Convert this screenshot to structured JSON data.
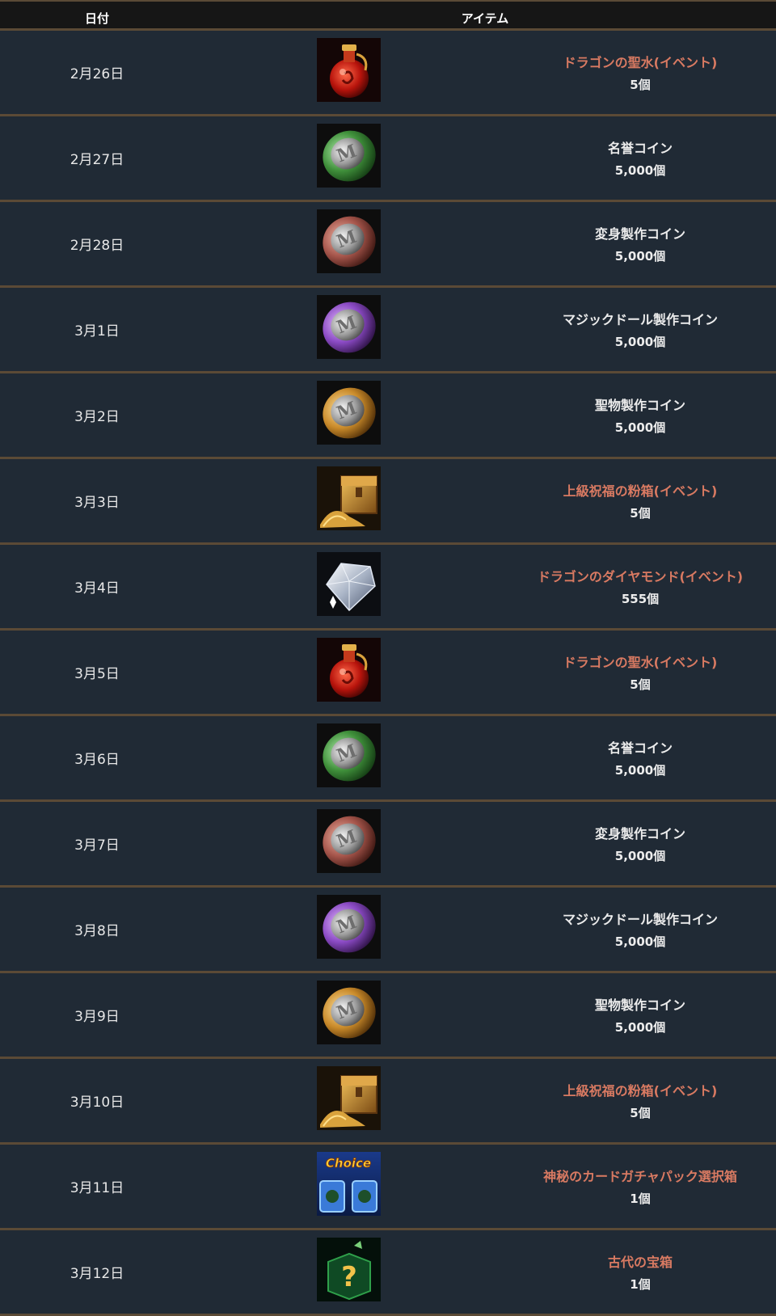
{
  "header": {
    "date_label": "日付",
    "item_label": "アイテム"
  },
  "colors": {
    "event_name": "#d97a62",
    "normal_name": "#ececec",
    "divider": "#5b4a36",
    "row_bg": "#202a35"
  },
  "rows": [
    {
      "date": "2月26日",
      "icon": "red-potion-icon",
      "name": "ドラゴンの聖水(イベント)",
      "qty": "5個",
      "event": true
    },
    {
      "date": "2月27日",
      "icon": "green-coin-icon",
      "name": "名誉コイン",
      "qty": "5,000個",
      "event": false
    },
    {
      "date": "2月28日",
      "icon": "copper-coin-icon",
      "name": "変身製作コイン",
      "qty": "5,000個",
      "event": false
    },
    {
      "date": "3月1日",
      "icon": "purple-coin-icon",
      "name": "マジックドール製作コイン",
      "qty": "5,000個",
      "event": false
    },
    {
      "date": "3月2日",
      "icon": "gold-coin-icon",
      "name": "聖物製作コイン",
      "qty": "5,000個",
      "event": false
    },
    {
      "date": "3月3日",
      "icon": "treasure-chest-icon",
      "name": "上級祝福の粉箱(イベント)",
      "qty": "5個",
      "event": true
    },
    {
      "date": "3月4日",
      "icon": "diamond-icon",
      "name": "ドラゴンのダイヤモンド(イベント)",
      "qty": "555個",
      "event": true
    },
    {
      "date": "3月5日",
      "icon": "red-potion-icon",
      "name": "ドラゴンの聖水(イベント)",
      "qty": "5個",
      "event": true
    },
    {
      "date": "3月6日",
      "icon": "green-coin-icon",
      "name": "名誉コイン",
      "qty": "5,000個",
      "event": false
    },
    {
      "date": "3月7日",
      "icon": "copper-coin-icon",
      "name": "変身製作コイン",
      "qty": "5,000個",
      "event": false
    },
    {
      "date": "3月8日",
      "icon": "purple-coin-icon",
      "name": "マジックドール製作コイン",
      "qty": "5,000個",
      "event": false
    },
    {
      "date": "3月9日",
      "icon": "gold-coin-icon",
      "name": "聖物製作コイン",
      "qty": "5,000個",
      "event": false
    },
    {
      "date": "3月10日",
      "icon": "treasure-chest-icon",
      "name": "上級祝福の粉箱(イベント)",
      "qty": "5個",
      "event": true
    },
    {
      "date": "3月11日",
      "icon": "choice-box-icon",
      "icon_text": "Choice",
      "name": "神秘のカードガチャパック選択箱",
      "qty": "1個",
      "event": true
    },
    {
      "date": "3月12日",
      "icon": "mystery-box-icon",
      "name": "古代の宝箱",
      "qty": "1個",
      "event": true
    }
  ]
}
